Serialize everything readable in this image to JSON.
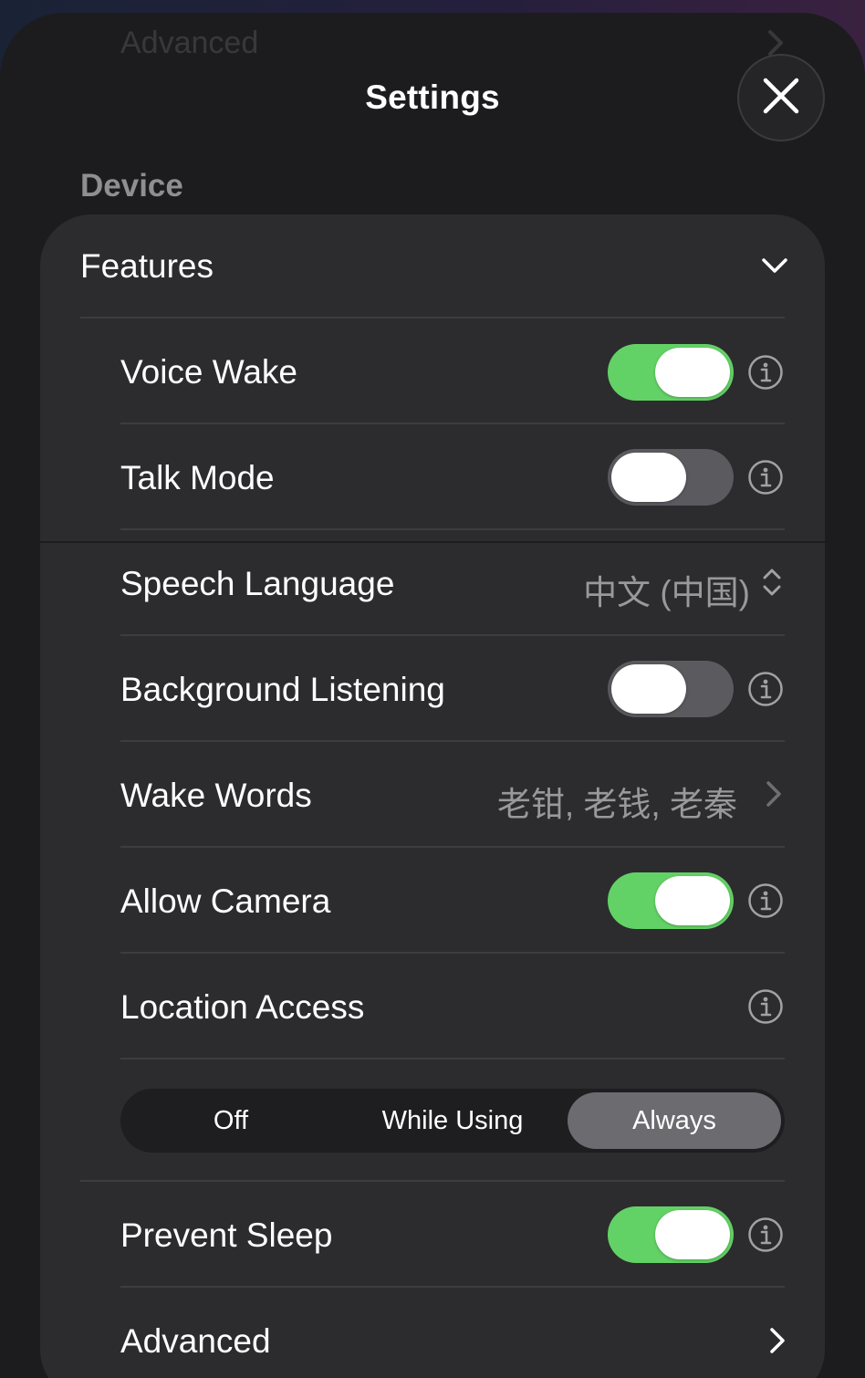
{
  "header": {
    "title": "Settings",
    "background_row_label": "Advanced"
  },
  "section": {
    "title": "Device"
  },
  "features": {
    "title": "Features",
    "rows": {
      "voice_wake": {
        "label": "Voice Wake",
        "on": true
      },
      "talk_mode": {
        "label": "Talk Mode",
        "on": false
      },
      "speech_language": {
        "label": "Speech Language",
        "value": "中文 (中国)"
      },
      "background_listening": {
        "label": "Background Listening",
        "on": false
      },
      "wake_words": {
        "label": "Wake Words",
        "value": "老钳, 老钱, 老秦"
      },
      "allow_camera": {
        "label": "Allow Camera",
        "on": true
      },
      "location_access": {
        "label": "Location Access",
        "options": [
          "Off",
          "While Using",
          "Always"
        ],
        "selected": "Always"
      },
      "prevent_sleep": {
        "label": "Prevent Sleep",
        "on": true
      },
      "advanced": {
        "label": "Advanced"
      }
    }
  },
  "colors": {
    "toggle_on": "#63d266",
    "toggle_off": "#5a5a5f",
    "card": "#2c2c2e",
    "sheet": "#1c1c1e",
    "secondary_text": "#98989d"
  },
  "icons": [
    "close-icon",
    "chevron-down-icon",
    "info-icon",
    "chevron-up-down-icon",
    "chevron-right-icon"
  ]
}
